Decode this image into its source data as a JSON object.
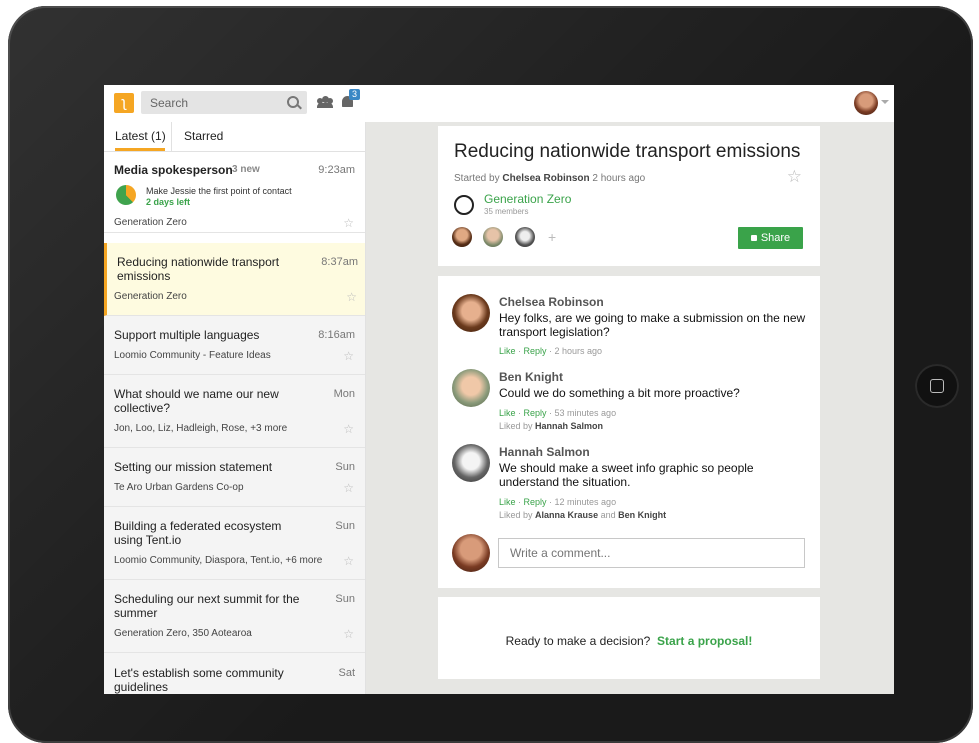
{
  "topbar": {
    "search_placeholder": "Search",
    "notification_count": "3"
  },
  "tabs": {
    "latest": "Latest (1)",
    "starred": "Starred"
  },
  "discussions": [
    {
      "title": "Media spokesperson",
      "new": "3 new",
      "time": "9:23am",
      "proposal": "Make Jessie the first point of contact",
      "days_left": "2 days left",
      "group": "Generation Zero"
    },
    {
      "title": "Reducing nationwide transport emissions",
      "time": "8:37am",
      "group": "Generation Zero"
    },
    {
      "title": "Support multiple languages",
      "time": "8:16am",
      "group": "Loomio Community - Feature Ideas"
    },
    {
      "title": "What should we name our new collective?",
      "time": "Mon",
      "group": "Jon, Loo, Liz, Hadleigh, Rose, +3 more"
    },
    {
      "title": "Setting our mission statement",
      "time": "Sun",
      "group": "Te Aro Urban Gardens Co-op"
    },
    {
      "title": "Building a federated ecosystem using Tent.io",
      "time": "Sun",
      "group": "Loomio Community, Diaspora, Tent.io, +6 more"
    },
    {
      "title": "Scheduling our next summit for the summer",
      "time": "Sun",
      "group": "Generation Zero, 350 Aotearoa"
    },
    {
      "title": "Let's establish some community guidelines",
      "time": "Sat",
      "group": ""
    }
  ],
  "thread": {
    "title": "Reducing nationwide transport emissions",
    "started_prefix": "Started by",
    "author": "Chelsea Robinson",
    "started_suffix": "2 hours ago",
    "group_name": "Generation Zero",
    "members": "35 members",
    "share_label": "Share"
  },
  "comments": [
    {
      "name": "Chelsea Robinson",
      "text": "Hey folks, are we going to make a submission on the new transport legislation?",
      "like": "Like",
      "reply": "Reply",
      "when": "2 hours ago"
    },
    {
      "name": "Ben Knight",
      "text": "Could we do something a bit more proactive?",
      "like": "Like",
      "reply": "Reply",
      "when": "53 minutes ago",
      "liked_prefix": "Liked by",
      "liked_by": "Hannah Salmon"
    },
    {
      "name": "Hannah Salmon",
      "text": "We should make a sweet info graphic so people understand the situation.",
      "like": "Like",
      "reply": "Reply",
      "when": "12 minutes ago",
      "liked_prefix": "Liked by",
      "liked_a": "Alanna Krause",
      "liked_and": "and",
      "liked_b": "Ben Knight"
    }
  ],
  "comment_input": {
    "placeholder": "Write a comment..."
  },
  "decision": {
    "prompt": "Ready to make a decision?",
    "link": "Start a proposal!"
  },
  "colors": {
    "accent": "#f5a623",
    "green": "#3aa34a",
    "badge": "#3a88c5"
  },
  "icons": [
    "logo-icon",
    "search-icon",
    "groups-icon",
    "bell-icon",
    "star-icon",
    "group-logo-icon",
    "lock-icon",
    "home-button-icon"
  ]
}
